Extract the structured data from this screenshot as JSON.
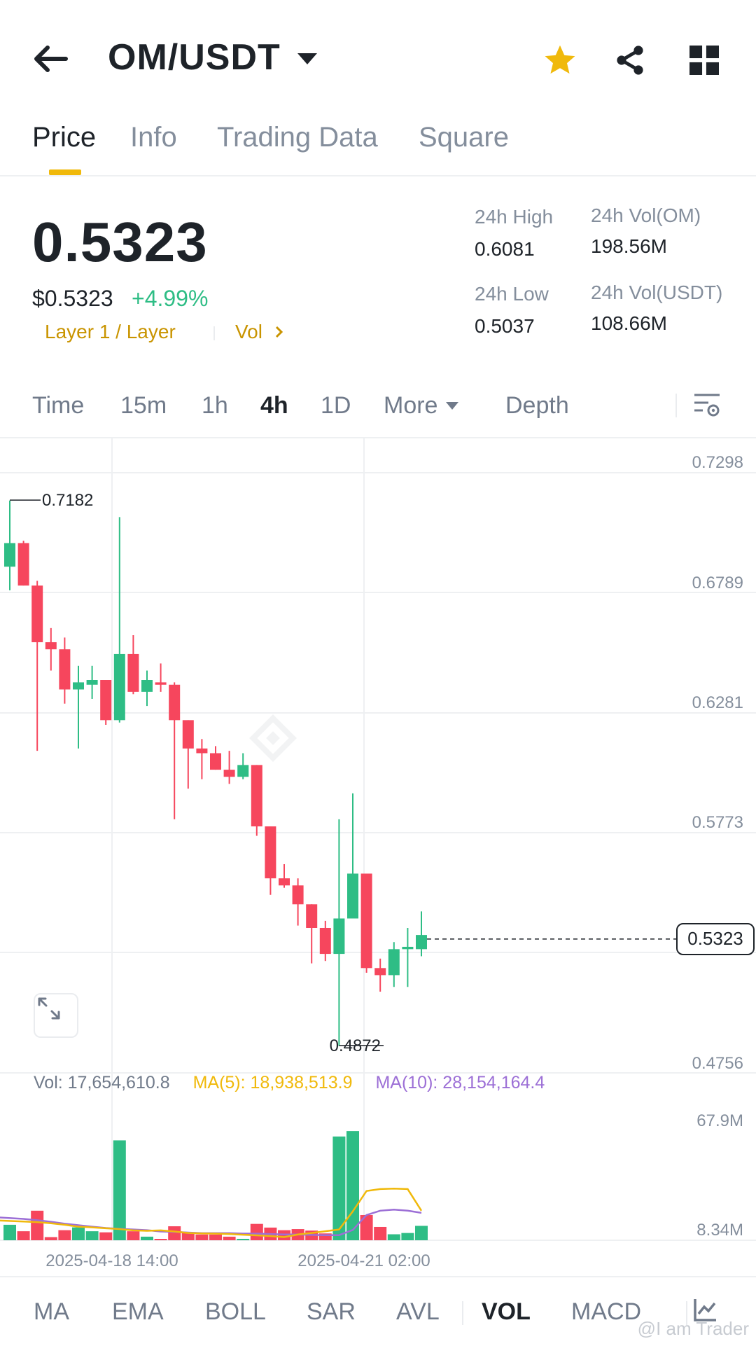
{
  "header": {
    "pair": "OM/USDT"
  },
  "tabs": [
    {
      "label": "Price",
      "active": true
    },
    {
      "label": "Info",
      "active": false
    },
    {
      "label": "Trading Data",
      "active": false
    },
    {
      "label": "Square",
      "active": false
    }
  ],
  "ticker": {
    "last_price": "0.5323",
    "usd_price": "$0.5323",
    "change": "+4.99%",
    "tag_layer": "Layer 1 / Layer",
    "tag_vol": "Vol",
    "high_label": "24h High",
    "high_value": "0.6081",
    "low_label": "24h Low",
    "low_value": "0.5037",
    "vol_base_label": "24h Vol(OM)",
    "vol_base_value": "198.56M",
    "vol_quote_label": "24h Vol(USDT)",
    "vol_quote_value": "108.66M"
  },
  "intervals": {
    "time": "Time",
    "m15": "15m",
    "h1": "1h",
    "h4": "4h",
    "d1": "1D",
    "more": "More",
    "depth": "Depth"
  },
  "chart_data": {
    "type": "candlestick",
    "interval": "4h",
    "price_axis_ticks": [
      "0.7298",
      "0.6789",
      "0.6281",
      "0.5773",
      "0.4756"
    ],
    "price_range": [
      0.4756,
      0.7298
    ],
    "current_price": "0.5323",
    "high_marker": "0.7182",
    "low_marker": "0.4872",
    "volume_axis_ticks": [
      "67.9M",
      "8.34M"
    ],
    "volume_range": [
      8.34,
      67.9
    ],
    "x_labels": [
      "2025-04-18 14:00",
      "2025-04-21 02:00"
    ],
    "vol_label": "Vol: 17,654,610.8",
    "ma5_label": "MA(5): 18,938,513.9",
    "ma10_label": "MA(10): 28,154,164.4",
    "colors": {
      "up": "#2ebd85",
      "down": "#f6465d",
      "ma5": "#f0b90b",
      "ma10": "#9c6fd6"
    },
    "candles": [
      {
        "o": 0.69,
        "h": 0.718,
        "l": 0.68,
        "c": 0.7
      },
      {
        "o": 0.7,
        "h": 0.701,
        "l": 0.682,
        "c": 0.682
      },
      {
        "o": 0.682,
        "h": 0.684,
        "l": 0.612,
        "c": 0.658
      },
      {
        "o": 0.658,
        "h": 0.664,
        "l": 0.646,
        "c": 0.655
      },
      {
        "o": 0.655,
        "h": 0.66,
        "l": 0.632,
        "c": 0.638
      },
      {
        "o": 0.638,
        "h": 0.648,
        "l": 0.613,
        "c": 0.641
      },
      {
        "o": 0.64,
        "h": 0.648,
        "l": 0.634,
        "c": 0.642
      },
      {
        "o": 0.642,
        "h": 0.642,
        "l": 0.623,
        "c": 0.625
      },
      {
        "o": 0.625,
        "h": 0.711,
        "l": 0.624,
        "c": 0.653
      },
      {
        "o": 0.653,
        "h": 0.661,
        "l": 0.636,
        "c": 0.637
      },
      {
        "o": 0.637,
        "h": 0.646,
        "l": 0.631,
        "c": 0.642
      },
      {
        "o": 0.641,
        "h": 0.649,
        "l": 0.637,
        "c": 0.64
      },
      {
        "o": 0.64,
        "h": 0.641,
        "l": 0.583,
        "c": 0.625
      },
      {
        "o": 0.625,
        "h": 0.625,
        "l": 0.596,
        "c": 0.613
      },
      {
        "o": 0.613,
        "h": 0.617,
        "l": 0.6,
        "c": 0.611
      },
      {
        "o": 0.611,
        "h": 0.614,
        "l": 0.604,
        "c": 0.604
      },
      {
        "o": 0.604,
        "h": 0.612,
        "l": 0.598,
        "c": 0.601
      },
      {
        "o": 0.601,
        "h": 0.611,
        "l": 0.6,
        "c": 0.606
      },
      {
        "o": 0.606,
        "h": 0.606,
        "l": 0.576,
        "c": 0.58
      },
      {
        "o": 0.58,
        "h": 0.58,
        "l": 0.551,
        "c": 0.558
      },
      {
        "o": 0.558,
        "h": 0.564,
        "l": 0.554,
        "c": 0.555
      },
      {
        "o": 0.555,
        "h": 0.558,
        "l": 0.538,
        "c": 0.547
      },
      {
        "o": 0.547,
        "h": 0.547,
        "l": 0.522,
        "c": 0.537
      },
      {
        "o": 0.537,
        "h": 0.54,
        "l": 0.523,
        "c": 0.526
      },
      {
        "o": 0.526,
        "h": 0.583,
        "l": 0.487,
        "c": 0.541
      },
      {
        "o": 0.541,
        "h": 0.594,
        "l": 0.541,
        "c": 0.56
      },
      {
        "o": 0.56,
        "h": 0.56,
        "l": 0.518,
        "c": 0.52
      },
      {
        "o": 0.52,
        "h": 0.524,
        "l": 0.51,
        "c": 0.517
      },
      {
        "o": 0.517,
        "h": 0.531,
        "l": 0.512,
        "c": 0.528
      },
      {
        "o": 0.528,
        "h": 0.537,
        "l": 0.512,
        "c": 0.529
      },
      {
        "o": 0.528,
        "h": 0.544,
        "l": 0.525,
        "c": 0.534
      }
    ],
    "volumes": [
      15.5,
      12.5,
      22.0,
      9.8,
      13.0,
      14.3,
      12.5,
      12.0,
      54.5,
      12.5,
      10.0,
      8.8,
      14.8,
      11.8,
      11.0,
      11.0,
      10.0,
      9.0,
      15.9,
      14.2,
      13.0,
      13.5,
      12.8,
      11.5,
      56.3,
      58.8,
      20.0,
      14.5,
      11.1,
      11.7,
      15.0
    ],
    "ma5": [
      17.5,
      17.0,
      16.7,
      16.2,
      15.5,
      14.6,
      14.3,
      13.9,
      13.5,
      12.9,
      12.7,
      12.9,
      12.4,
      11.7,
      11.5,
      11.4,
      11.2,
      10.9,
      10.6,
      10.3,
      9.8,
      11.0,
      11.7,
      12.5,
      13.3,
      21.7,
      31.1,
      32.0,
      32.2,
      32.0,
      22.0
    ],
    "ma10": [
      19.0,
      18.2,
      17.6,
      16.9,
      16.0,
      15.3,
      14.6,
      14.0,
      13.6,
      13.3,
      13.0,
      12.4,
      12.2,
      11.9,
      11.6,
      11.6,
      11.6,
      11.4,
      11.4,
      11.2,
      11.0,
      11.0,
      10.8,
      10.7,
      10.7,
      13.1,
      20.0,
      22.0,
      22.5,
      22.0,
      21.0
    ]
  },
  "indicators": [
    {
      "label": "MA",
      "active": false
    },
    {
      "label": "EMA",
      "active": false
    },
    {
      "label": "BOLL",
      "active": false
    },
    {
      "label": "SAR",
      "active": false
    },
    {
      "label": "AVL",
      "active": false
    },
    {
      "label": "VOL",
      "active": true
    },
    {
      "label": "MACD",
      "active": false
    }
  ],
  "icons": {
    "back": "arrow-left-icon",
    "favorite": "star-icon",
    "share": "share-icon",
    "menu": "grid-icon",
    "chart_settings": "chart-settings-icon",
    "expand": "expand-icon",
    "indicator_settings": "indicator-settings-icon"
  },
  "watermark": "@I am Trader"
}
